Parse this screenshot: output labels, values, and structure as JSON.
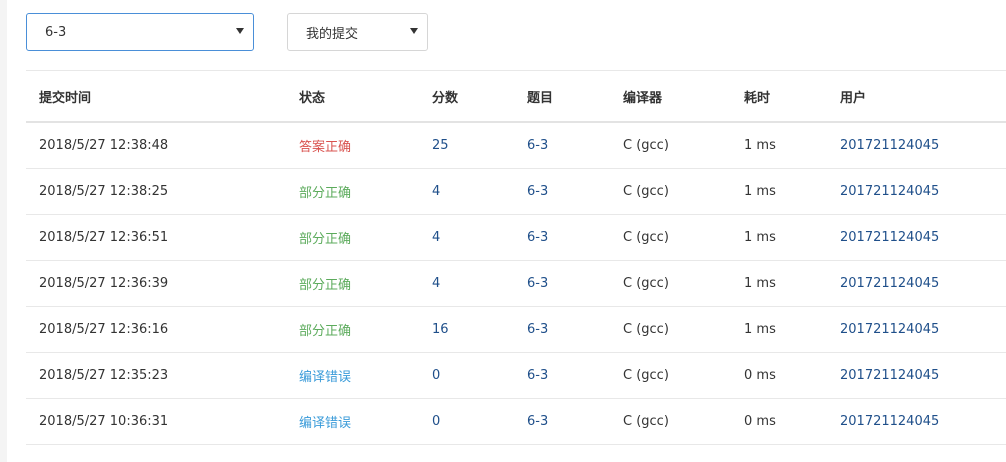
{
  "filters": {
    "problem_select": "6-3",
    "scope_select": "我的提交"
  },
  "table": {
    "headers": [
      "提交时间",
      "状态",
      "分数",
      "题目",
      "编译器",
      "耗时",
      "用户"
    ],
    "rows": [
      {
        "time": "2018/5/27 12:38:48",
        "status": "答案正确",
        "status_color": "#d9534f",
        "score": "25",
        "problem": "6-3",
        "compiler": "C (gcc)",
        "cost": "1 ms",
        "user": "201721124045"
      },
      {
        "time": "2018/5/27 12:38:25",
        "status": "部分正确",
        "status_color": "#5cab5c",
        "score": "4",
        "problem": "6-3",
        "compiler": "C (gcc)",
        "cost": "1 ms",
        "user": "201721124045"
      },
      {
        "time": "2018/5/27 12:36:51",
        "status": "部分正确",
        "status_color": "#5cab5c",
        "score": "4",
        "problem": "6-3",
        "compiler": "C (gcc)",
        "cost": "1 ms",
        "user": "201721124045"
      },
      {
        "time": "2018/5/27 12:36:39",
        "status": "部分正确",
        "status_color": "#5cab5c",
        "score": "4",
        "problem": "6-3",
        "compiler": "C (gcc)",
        "cost": "1 ms",
        "user": "201721124045"
      },
      {
        "time": "2018/5/27 12:36:16",
        "status": "部分正确",
        "status_color": "#5cab5c",
        "score": "16",
        "problem": "6-3",
        "compiler": "C (gcc)",
        "cost": "1 ms",
        "user": "201721124045"
      },
      {
        "time": "2018/5/27 12:35:23",
        "status": "编译错误",
        "status_color": "#3a9bd9",
        "score": "0",
        "problem": "6-3",
        "compiler": "C (gcc)",
        "cost": "0 ms",
        "user": "201721124045"
      },
      {
        "time": "2018/5/27 10:36:31",
        "status": "编译错误",
        "status_color": "#3a9bd9",
        "score": "0",
        "problem": "6-3",
        "compiler": "C (gcc)",
        "cost": "0 ms",
        "user": "201721124045"
      }
    ]
  }
}
